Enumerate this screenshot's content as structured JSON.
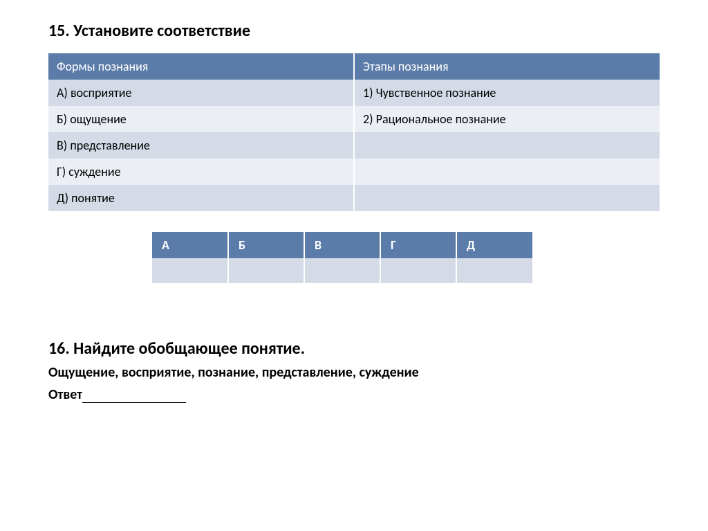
{
  "q15": {
    "title": "15. Установите соответствие",
    "headers": {
      "left": "Формы познания",
      "right": "Этапы  познания"
    },
    "rows": [
      {
        "left": "А) восприятие",
        "right": "1) Чувственное познание"
      },
      {
        "left": "Б) ощущение",
        "right": "2) Рациональное познание"
      },
      {
        "left": "В) представление",
        "right": ""
      },
      {
        "left": "Г) суждение",
        "right": ""
      },
      {
        "left": "Д) понятие",
        "right": ""
      }
    ],
    "answer_headers": [
      "А",
      "Б",
      "В",
      "Г",
      "Д"
    ],
    "answer_values": [
      "",
      "",
      "",
      "",
      ""
    ]
  },
  "q16": {
    "title": "16. Найдите обобщающее понятие.",
    "items": "Ощущение, восприятие, познание, представление, суждение",
    "answer_label": "Ответ"
  }
}
